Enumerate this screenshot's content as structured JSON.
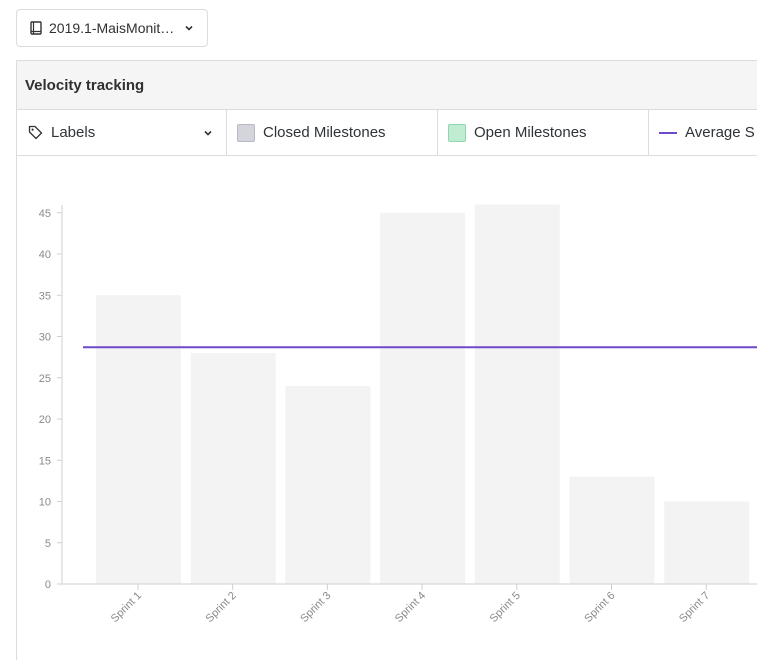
{
  "repo_select": {
    "label": "2019.1-MaisMonit…",
    "icon": "book-icon"
  },
  "panel": {
    "title": "Velocity tracking"
  },
  "legend": {
    "labels_dropdown": "Labels",
    "closed_milestones": "Closed Milestones",
    "open_milestones": "Open Milestones",
    "average": "Average S"
  },
  "colors": {
    "closed_bar": "#f3f3f4",
    "average_line": "#6e49cb",
    "closed_swatch": "#d4d4dc",
    "open_swatch": "#c0ecd4"
  },
  "chart_data": {
    "type": "bar",
    "categories": [
      "Sprint 1",
      "Sprint 2",
      "Sprint 3",
      "Sprint 4",
      "Sprint 5",
      "Sprint 6",
      "Sprint 7"
    ],
    "series": [
      {
        "name": "Closed Milestones",
        "values": [
          35,
          28,
          24,
          45,
          46,
          13,
          10
        ]
      }
    ],
    "average": 28.7,
    "yticks": [
      0,
      5,
      10,
      15,
      20,
      25,
      30,
      35,
      40,
      45
    ],
    "ylim": [
      0,
      46
    ],
    "grid": false,
    "legend_position": "top"
  }
}
